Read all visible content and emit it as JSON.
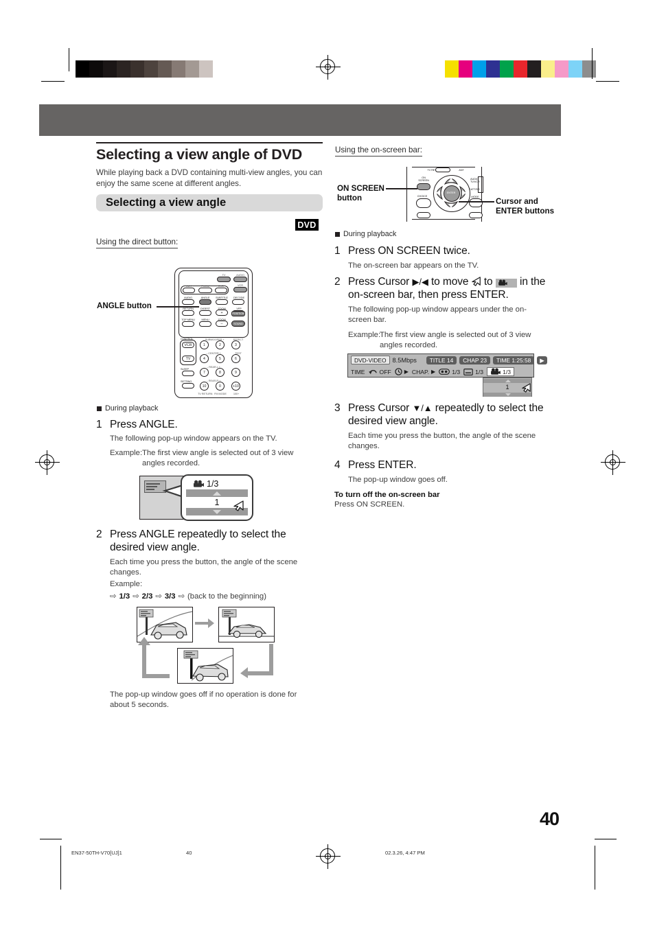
{
  "page": {
    "number": "40",
    "footer": {
      "code": "EN37-50TH-V70[UJ]1",
      "page": "40",
      "timestamp": "02.3.26, 4:47 PM"
    }
  },
  "colorbars": {
    "gray": [
      "#000000",
      "#0d0a0a",
      "#1b1616",
      "#2b2422",
      "#3a312d",
      "#4d433e",
      "#655a54",
      "#867a74",
      "#a39993",
      "#cdc4c0",
      "#ffffff"
    ],
    "color": [
      "#f5e000",
      "#e6007e",
      "#00a0e9",
      "#2e3192",
      "#00a24b",
      "#e8262c",
      "#231f20",
      "#faee8b",
      "#f59ac8",
      "#7dd3f7",
      "#8d8d8d"
    ]
  },
  "left": {
    "title": "Selecting a view angle of DVD",
    "lead": "While playing back a DVD containing multi-view angles, you can enjoy the same scene at different angles.",
    "section_title": "Selecting a view angle",
    "disc_tag": "DVD",
    "subhead": "Using the direct button:",
    "remote_callout": "ANGLE button",
    "during_playback": "During playback",
    "steps": [
      {
        "no": "1",
        "title": "Press ANGLE.",
        "body": "The following pop-up window appears on the TV.",
        "example_label": "Example:",
        "example_text": "The first view angle is selected out of 3 view angles recorded."
      },
      {
        "no": "2",
        "title": "Press ANGLE repeatedly to select the desired view angle.",
        "body": "Each time you press the button, the angle of the scene changes.",
        "example_label": "Example:",
        "cycle": [
          "1/3",
          "2/3",
          "3/3"
        ],
        "cycle_tail": "(back to the beginning)",
        "note": "The pop-up window goes off if no operation is done for about 5 seconds."
      }
    ],
    "popup": {
      "angle_icon": "angle-camera-icon",
      "counter": "1/3",
      "value": "1",
      "up_icon": "triangle-up-icon",
      "down_icon": "triangle-down-icon",
      "cursor_icon": "cursor-arrow-icon"
    },
    "remote": {
      "power_labels": [
        "TV",
        "AUDIO",
        "VCR"
      ],
      "source_labels": [
        "AUX",
        "FM/AM",
        "DVD"
      ],
      "row_a": [
        "AUDIO",
        "ANGLE",
        "SUBTITLE",
        "DECODE"
      ],
      "row_b": [
        "RETURN",
        "DIGEST",
        "ZOOM",
        "VFP"
      ],
      "row_c": [
        "TOP MENU",
        "MENU",
        "ZOOM"
      ],
      "zoom_plus": "+",
      "zoom_minus": "–",
      "position_label": "POSITION",
      "sound_label": "SOUND",
      "control_label": "CONTROL",
      "control_buttons": [
        "VCR",
        "TV"
      ],
      "sleep_label": "SLEEP",
      "setting_label": "SETTING",
      "channel_labels": [
        "– SUBWOOFER +",
        "– CENTER +",
        "– REAR-L +",
        "– REAR-R +"
      ],
      "right_labels": [
        "EFFECT",
        "TEST"
      ],
      "numbers": [
        "1",
        "2",
        "3",
        "4",
        "5",
        "6",
        "7",
        "8",
        "9",
        "10",
        "0",
        "+10"
      ],
      "num_sublabels": [
        "TV RETURN",
        "FM MODE",
        "100+"
      ]
    }
  },
  "right": {
    "subhead": "Using the on-screen bar:",
    "callout_left": "ON SCREEN\nbutton",
    "callout_left_l1": "ON SCREEN",
    "callout_left_l2": "button",
    "callout_right_l1": "Cursor and",
    "callout_right_l2": "ENTER buttons",
    "remote": {
      "on_screen_label": "ON SCREEN",
      "choice_label": "CHOICE",
      "enter_label": "ENTER",
      "audio_tvvcr_label": "AUDIO\nTV/VCR",
      "cattods_label": "CATT/DS",
      "mode_label": "MODE",
      "tv_return_label": "TV RETURN"
    },
    "during_playback": "During playback",
    "steps": [
      {
        "no": "1",
        "title": "Press ON SCREEN twice.",
        "body": "The on-screen bar appears on the TV."
      },
      {
        "no": "2",
        "title_p1": "Press Cursor ",
        "title_cursor": "▶/◀",
        "title_p2": " to move ",
        "title_p3": " to ",
        "title_p4": " in the on-screen bar, then press ENTER.",
        "body": "The following pop-up window appears under the on-screen bar.",
        "example_label": "Example:",
        "example_text": "The first view angle is selected out of 3 view angles recorded."
      },
      {
        "no": "3",
        "title_p1": "Press Cursor ",
        "title_cursor": "▼/▲",
        "title_p2": " repeatedly to select the desired view angle.",
        "body": "Each time you press the button, the angle of the scene changes."
      },
      {
        "no": "4",
        "title": "Press ENTER.",
        "body": "The pop-up window goes off."
      }
    ],
    "turn_off": {
      "heading": "To turn off the on-screen bar",
      "body": "Press ON SCREEN."
    },
    "onscreen_bar": {
      "row1": {
        "disc_type": "DVD-VIDEO",
        "bitrate": "8.5Mbps",
        "title_chip": "TITLE 14",
        "chapter_chip": "CHAP 23",
        "time_chip": "TIME 1:25:58",
        "play_icon": "play-icon"
      },
      "row2": {
        "time_label": "TIME",
        "repeat_icon": "repeat-icon",
        "repeat_value": "OFF",
        "clock_icon": "clock-icon",
        "clock_arrow": "▶",
        "chapter_label": "CHAP.",
        "chapter_arrow": "▶",
        "audio_icon": "audio-icon",
        "audio_value": "1/3",
        "subtitle_icon": "subtitle-icon",
        "subtitle_value": "1/3",
        "angle_icon": "angle-camera-icon",
        "angle_value": "1/3"
      },
      "popup": {
        "up_icon": "triangle-up-icon",
        "value": "1",
        "down_icon": "triangle-down-icon",
        "cursor_icon": "cursor-arrow-icon"
      }
    }
  }
}
